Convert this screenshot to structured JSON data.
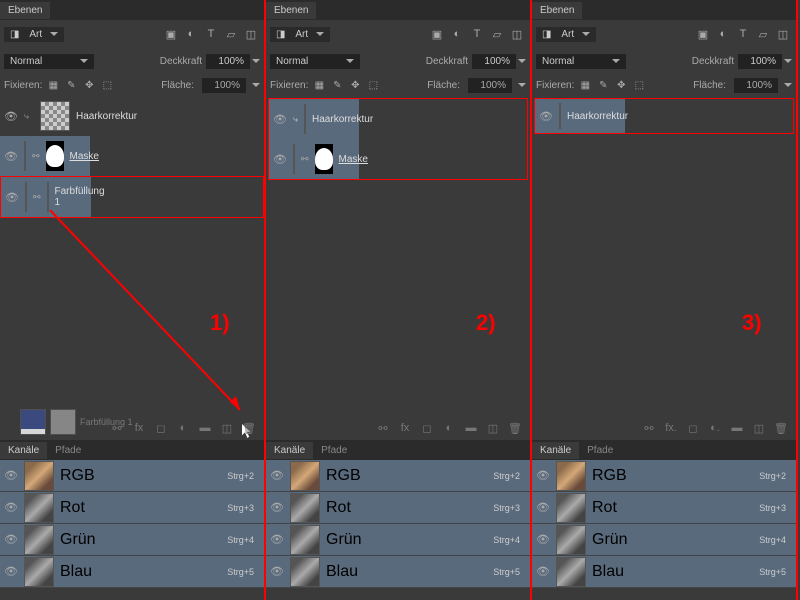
{
  "tabs": {
    "layers": "Ebenen",
    "channels": "Kanäle",
    "paths": "Pfade"
  },
  "search": "Art",
  "blend": "Normal",
  "opacity": {
    "label": "Deckkraft",
    "value": "100%"
  },
  "fill": {
    "label": "Fläche:",
    "value": "100%"
  },
  "lock": "Fixieren:",
  "layers1": [
    {
      "name": "Haarkorrektur"
    },
    {
      "name": "Maske"
    },
    {
      "name": "Farbfüllung 1"
    }
  ],
  "layers2": [
    {
      "name": "Haarkorrektur"
    },
    {
      "name": "Maske"
    }
  ],
  "layers3": [
    {
      "name": "Haarkorrektur"
    }
  ],
  "dragLabel": "Farbfüllung 1",
  "channels": [
    {
      "name": "RGB",
      "shortcut": "Strg+2"
    },
    {
      "name": "Rot",
      "shortcut": "Strg+3"
    },
    {
      "name": "Grün",
      "shortcut": "Strg+4"
    },
    {
      "name": "Blau",
      "shortcut": "Strg+5"
    }
  ],
  "steps": [
    "1)",
    "2)",
    "3)"
  ]
}
